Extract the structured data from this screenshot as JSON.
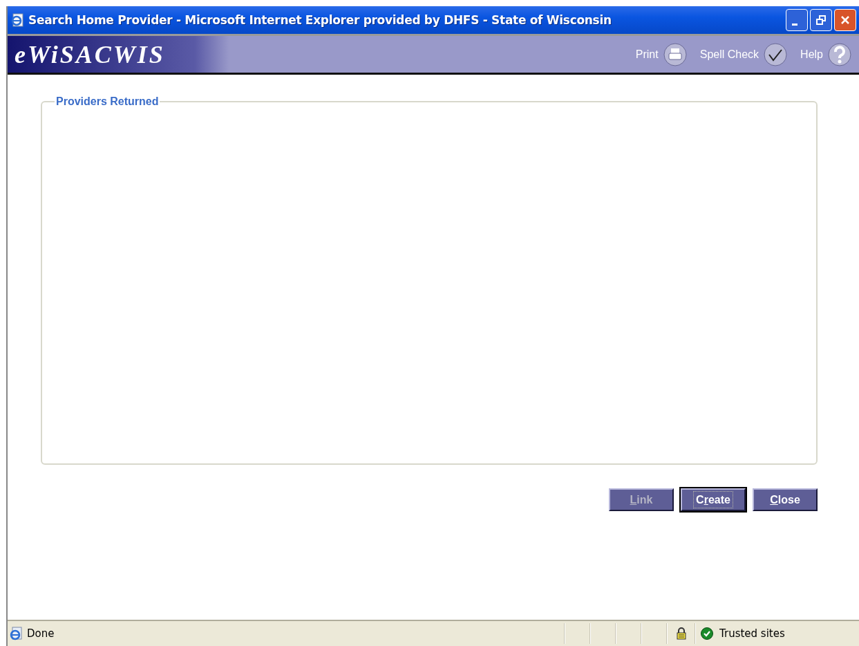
{
  "window": {
    "title": "Search Home Provider - Microsoft Internet Explorer provided by DHFS - State of Wisconsin"
  },
  "header": {
    "logo": "eWiSACWIS",
    "tools": [
      {
        "kind": "print",
        "label": "Print"
      },
      {
        "kind": "spellcheck",
        "label": "Spell Check"
      },
      {
        "kind": "help",
        "label": "Help"
      }
    ]
  },
  "providers_panel": {
    "title": "Providers Returned"
  },
  "buttons": [
    {
      "mnemonic": "L",
      "rest": "ink",
      "disabled": true,
      "focused": false
    },
    {
      "prefix": "C",
      "mnemonic": "r",
      "rest": "eate",
      "disabled": false,
      "focused": true
    },
    {
      "mnemonic": "C",
      "rest": "lose",
      "disabled": false,
      "focused": false
    }
  ],
  "status_bar": {
    "text": "Done",
    "zone": "Trusted sites",
    "secure": true
  }
}
